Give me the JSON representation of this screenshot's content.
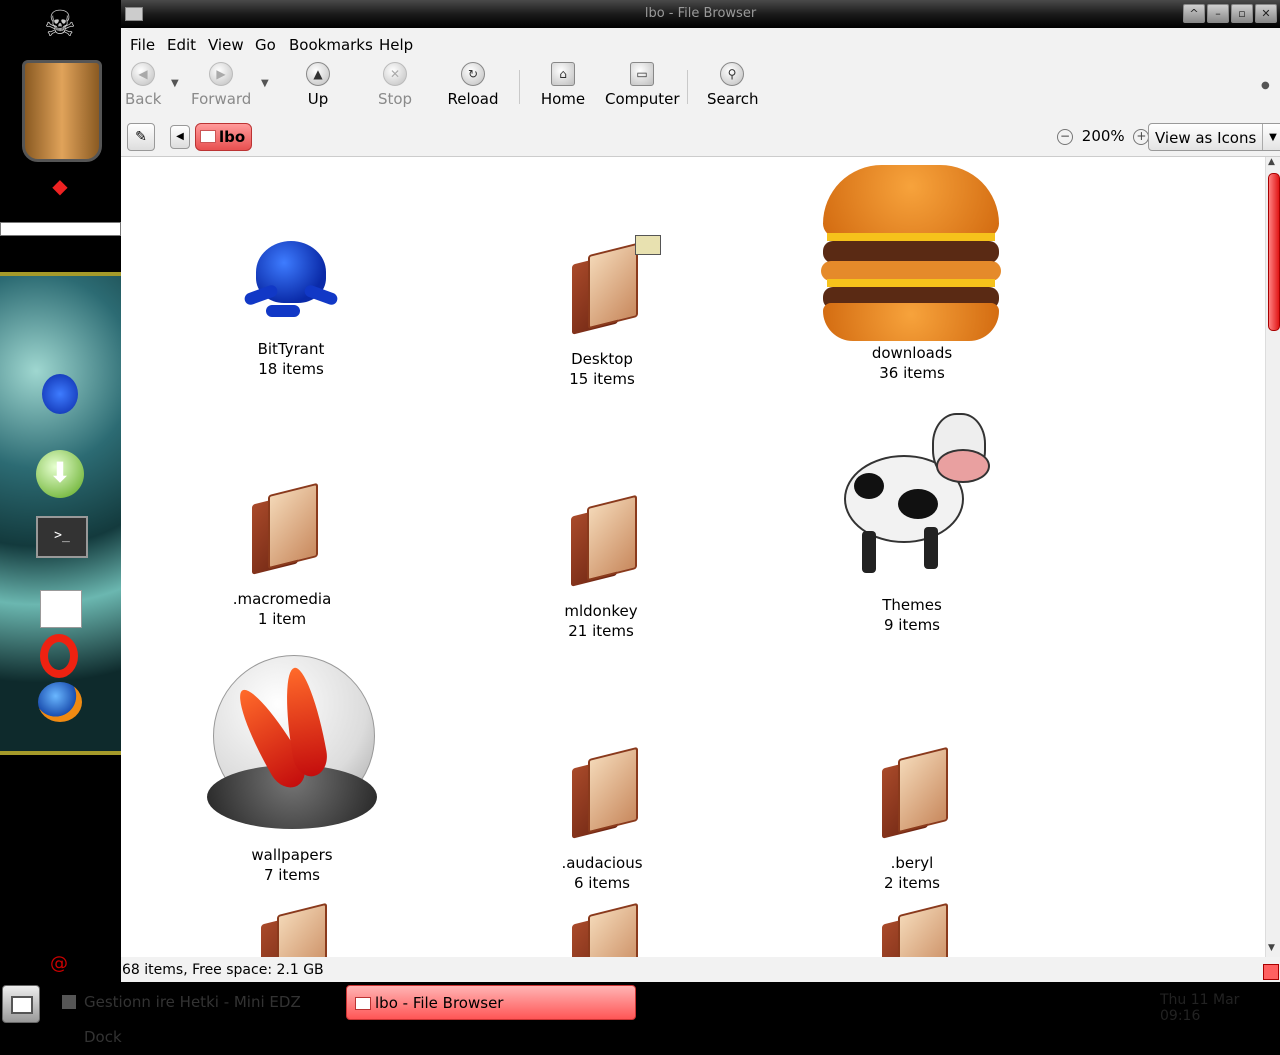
{
  "window": {
    "title": "lbo - File Browser"
  },
  "menu": [
    "File",
    "Edit",
    "View",
    "Go",
    "Bookmarks",
    "Help"
  ],
  "toolbar": {
    "back": "Back",
    "forward": "Forward",
    "up": "Up",
    "stop": "Stop",
    "reload": "Reload",
    "home": "Home",
    "computer": "Computer",
    "search": "Search"
  },
  "location": {
    "crumb": "lbo",
    "zoom": "200%",
    "view_mode": "View as Icons"
  },
  "items": [
    {
      "name": "BitTyrant",
      "count": "18 items"
    },
    {
      "name": "Desktop",
      "count": "15 items"
    },
    {
      "name": "downloads",
      "count": "36 items"
    },
    {
      "name": ".macromedia",
      "count": "1 item"
    },
    {
      "name": "mldonkey",
      "count": "21 items"
    },
    {
      "name": "Themes",
      "count": "9 items"
    },
    {
      "name": "wallpapers",
      "count": "7 items"
    },
    {
      "name": ".audacious",
      "count": "6 items"
    },
    {
      "name": ".beryl",
      "count": "2 items"
    }
  ],
  "status": "68 items, Free space: 2.1 GB",
  "taskbar": {
    "task1": "Gestionn ire Hetki - Mini EDZ Dock",
    "task2": "lbo - File Browser",
    "clock": "Thu 11 Mar 09:16"
  }
}
